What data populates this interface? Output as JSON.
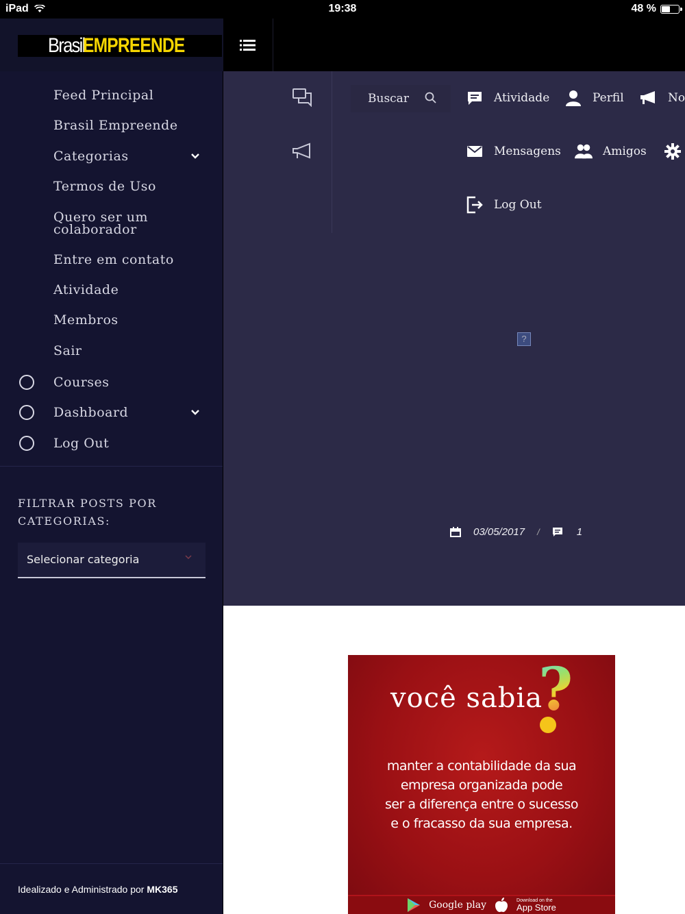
{
  "status_bar": {
    "device": "iPad",
    "time": "19:38",
    "battery": "48 %",
    "battery_level": 0.48
  },
  "brand": {
    "part1": "Brasil",
    "part2": "EMPREENDE"
  },
  "sidebar": {
    "items": [
      {
        "label": "Feed Principal"
      },
      {
        "label": "Brasil Empreende"
      },
      {
        "label": "Categorias",
        "has_submenu": true
      },
      {
        "label": "Termos de Uso"
      },
      {
        "label": "Quero ser um colaborador"
      },
      {
        "label": "Entre em contato"
      },
      {
        "label": "Atividade"
      },
      {
        "label": "Membros"
      },
      {
        "label": "Sair"
      },
      {
        "label": "Courses",
        "icon": "circle-icon"
      },
      {
        "label": "Dashboard",
        "icon": "circle-icon",
        "has_submenu": true
      },
      {
        "label": "Log Out",
        "icon": "circle-icon"
      }
    ],
    "filter_title": "FILTRAR POSTS POR CATEGORIAS:",
    "filter_select": "Selecionar categoria",
    "credit_prefix": "Idealizado e Administrado por ",
    "credit_brand": "MK365"
  },
  "topnav": {
    "search_label": "Buscar",
    "links": [
      {
        "label": "Atividade",
        "icon": "activity-icon"
      },
      {
        "label": "Perfil",
        "icon": "user-icon"
      },
      {
        "label": "No",
        "icon": "megaphone-icon"
      },
      {
        "label": "Mensagens",
        "icon": "envelope-icon"
      },
      {
        "label": "Amigos",
        "icon": "friends-icon"
      },
      {
        "label": "",
        "icon": "gear-icon"
      },
      {
        "label": "Log Out",
        "icon": "logout-icon"
      }
    ]
  },
  "post_meta": {
    "date": "03/05/2017",
    "separator": "/",
    "comments": "1"
  },
  "promo": {
    "title": "você sabia",
    "text": [
      "manter a contabilidade da sua",
      "empresa organizada pode",
      "ser a diferença entre o sucesso",
      "e o fracasso da sua empresa."
    ],
    "google_play": "Google play",
    "app_store_sub": "Download on the",
    "app_store": "App Store"
  },
  "colors": {
    "sidebar_bg": "#141430",
    "main_bg": "#2c2a47",
    "brand_yellow": "#f5d500",
    "promo_red": "#9a1014"
  }
}
